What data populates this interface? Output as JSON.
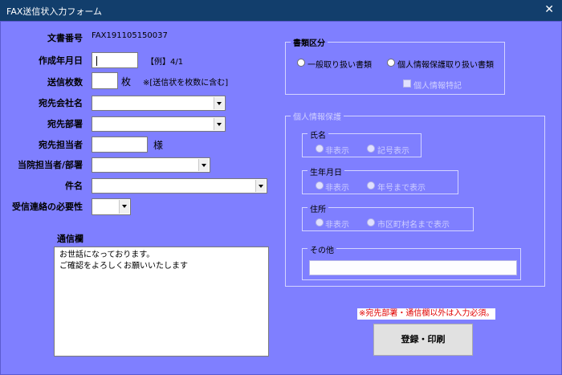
{
  "window": {
    "title": "FAX送信状入力フォーム",
    "close": "✕"
  },
  "doc": {
    "label": "文書番号",
    "value": "FAX191105150037"
  },
  "date": {
    "label": "作成年月日",
    "value": "",
    "hint": "【例】4/1"
  },
  "pages": {
    "label": "送信枚数",
    "value": "",
    "unit": "枚",
    "hint": "※[送信状を枚数に含む]"
  },
  "company": {
    "label": "宛先会社名",
    "value": ""
  },
  "dept": {
    "label": "宛先部署",
    "value": ""
  },
  "person": {
    "label": "宛先担当者",
    "value": "",
    "unit": "様"
  },
  "staff": {
    "label": "当院担当者/部署",
    "value": ""
  },
  "subject": {
    "label": "件名",
    "value": ""
  },
  "reply": {
    "label": "受信連絡の必要性",
    "value": ""
  },
  "memo": {
    "label": "通信欄",
    "value": "お世話になっております。\nご確認をよろしくお願いいたします"
  },
  "doctype": {
    "legend": "書類区分",
    "general": "一般取り扱い書類",
    "personal": "個人情報保護取り扱い書類",
    "note": "個人情報特記"
  },
  "privacy": {
    "legend": "個人情報保護",
    "name": {
      "legend": "氏名",
      "opt1": "非表示",
      "opt2": "記号表示"
    },
    "birth": {
      "legend": "生年月日",
      "opt1": "非表示",
      "opt2": "年号まで表示"
    },
    "addr": {
      "legend": "住所",
      "opt1": "非表示",
      "opt2": "市区町村名まで表示"
    },
    "other": {
      "legend": "その他",
      "value": ""
    }
  },
  "warning": "※宛先部署・通信欄以外は入力必須。",
  "submit": "登録・印刷",
  "colors": {
    "form_bg": "#7f7fff",
    "titlebar": "#123e6c",
    "warning": "#e00000"
  }
}
